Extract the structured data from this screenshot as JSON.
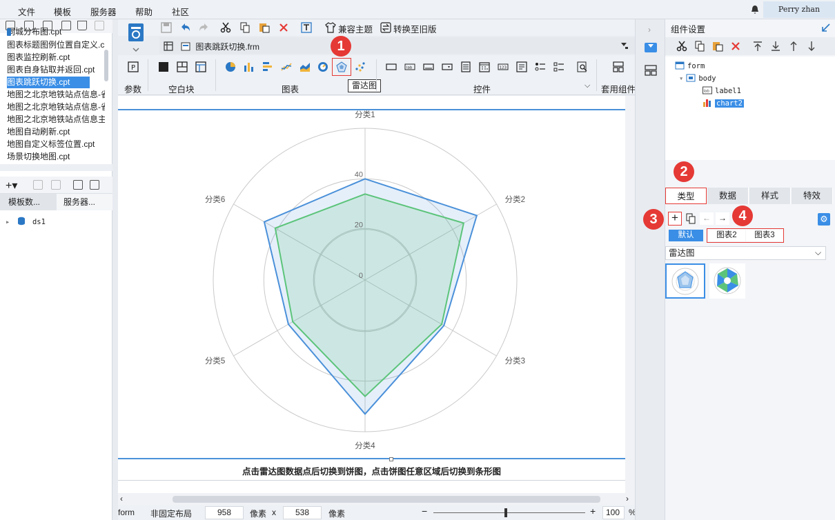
{
  "menu": [
    "文件",
    "模板",
    "服务器",
    "帮助",
    "社区"
  ],
  "user": "Perry zhan",
  "files": [
    "同城分布图.cpt",
    "图表标题图例位置自定义.cpt",
    "图表监控刷新.cpt",
    "图表自身钻取并返回.cpt",
    "图表跳跃切换.cpt",
    "地图之北京地铁站点信息-省",
    "地图之北京地铁站点信息-省",
    "地图之北京地铁站点信息主",
    "地图自动刷新.cpt",
    "地图自定义标签位置.cpt",
    "场景切换地图.cpt"
  ],
  "left_tabs": [
    "模板数...",
    "服务器..."
  ],
  "datasource": "ds1",
  "toolbar": {
    "compat_theme": "兼容主题",
    "convert_old": "转换至旧版"
  },
  "file_tab": {
    "name": "图表跳跃切换.frm"
  },
  "ribbon": {
    "param": "参数",
    "blank": "空白块",
    "chart": "图表",
    "control": "控件",
    "apply": "套用组件",
    "tooltip": "雷达图"
  },
  "chart_data": {
    "type": "radar",
    "categories": [
      "分类1",
      "分类2",
      "分类3",
      "分类4",
      "分类5",
      "分类6"
    ],
    "axis_ticks": [
      0,
      20,
      40
    ],
    "rmax": 60,
    "series": [
      {
        "values": [
          40,
          51,
          36,
          53,
          35,
          46
        ],
        "color": "#4a90d9"
      },
      {
        "values": [
          34,
          45,
          35,
          46,
          33,
          41
        ],
        "color": "#5cc47a"
      }
    ]
  },
  "hint": "点击雷达图数据点后切换到饼图，点击饼图任意区域后切换到条形图",
  "status": {
    "layout": "form",
    "fixed": "非固定布局",
    "width": "958",
    "unit1": "像素",
    "x": "x",
    "height": "538",
    "unit2": "像素",
    "zoom": "100",
    "pct": "%"
  },
  "right": {
    "title": "组件设置",
    "tree": [
      "form",
      "body",
      "label1",
      "chart2"
    ],
    "tabs": [
      "类型",
      "数据",
      "样式",
      "特效"
    ],
    "subtabs": [
      "默认",
      "图表2",
      "图表3"
    ],
    "chart_type": "雷达图"
  },
  "badges": [
    "1",
    "2",
    "3",
    "4"
  ]
}
